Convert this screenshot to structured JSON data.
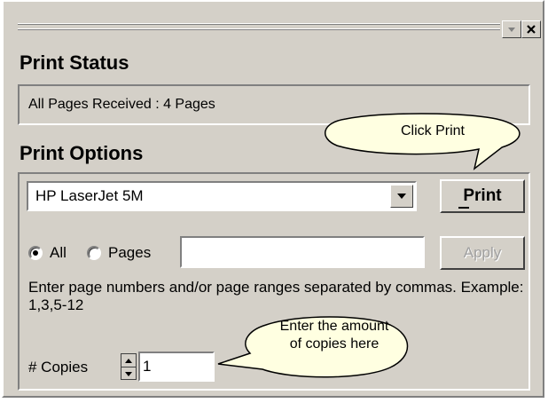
{
  "window": {
    "minimize_label": "▾",
    "close_label": "×"
  },
  "status": {
    "heading": "Print Status",
    "text": "All Pages Received : 4 Pages"
  },
  "options": {
    "heading": "Print Options",
    "printer_selected": "HP LaserJet 5M",
    "print_label": "Print",
    "radio_all_label": "All",
    "radio_pages_label": "Pages",
    "selected_range": "All",
    "pages_value": "",
    "apply_label": "Apply",
    "help_text": "Enter page numbers and/or page ranges separated by commas.  Example:  1,3,5-12",
    "copies_label": "# Copies",
    "copies_value": "1"
  },
  "callouts": {
    "print_hint": "Click Print",
    "copies_hint_line1": "Enter the amount",
    "copies_hint_line2": "of copies here"
  },
  "colors": {
    "panel_bg": "#d4d0c8",
    "callout_bg": "#ffffe1"
  }
}
